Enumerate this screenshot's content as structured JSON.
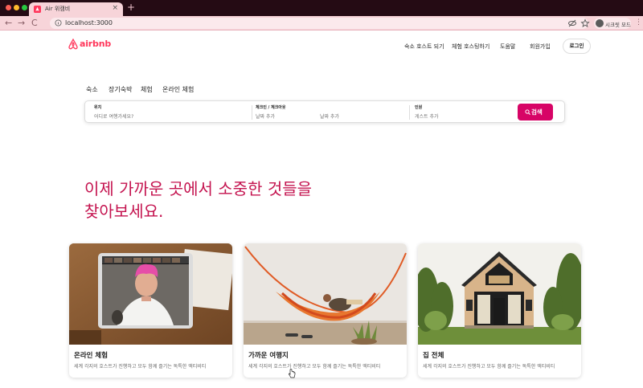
{
  "browser": {
    "tab_title": "Air 위캠비",
    "tab_close": "×",
    "new_tab": "+",
    "url": "localhost:3000",
    "profile_label": "시크릿 모드",
    "back": "←",
    "forward": "→",
    "reload": "C",
    "more": "⋮"
  },
  "header": {
    "logo_text": "airbnb",
    "nav": [
      "숙소 호스트 되기",
      "체험 호스팅하기",
      "도움말",
      "회원가입"
    ],
    "login_label": "로그인"
  },
  "categories": [
    "숙소",
    "장기숙박",
    "체험",
    "온라인 체험"
  ],
  "search": {
    "location_label": "위치",
    "location_placeholder": "어디로 여행가세요?",
    "dates_label": "체크인 / 체크아웃",
    "checkin_placeholder": "날짜 추가",
    "checkout_placeholder": "날짜 추가",
    "guests_label": "인원",
    "guests_placeholder": "게스트 추가",
    "button_label": "검색"
  },
  "hero": {
    "line1": "이제 가까운 곳에서 소중한 것들을",
    "line2": "찾아보세요."
  },
  "cards": [
    {
      "title": "온라인 체험",
      "desc": "세계 각지의 호스트가 진행하고 모두 함께 즐기는 독특한 액티비티"
    },
    {
      "title": "가까운 여행지",
      "desc": "세계 각지의 호스트가 진행하고 모두 함께 즐기는 독특한 액티비티"
    },
    {
      "title": "집 전체",
      "desc": "세계 각지의 호스트가 진행하고 모두 함께 즐기는 독특한 액티비티"
    }
  ],
  "colors": {
    "brand": "#ff385c",
    "accent": "#d70466",
    "headline": "#c4134f",
    "tabbar": "#250b14",
    "chrome": "#f7d4d9"
  }
}
